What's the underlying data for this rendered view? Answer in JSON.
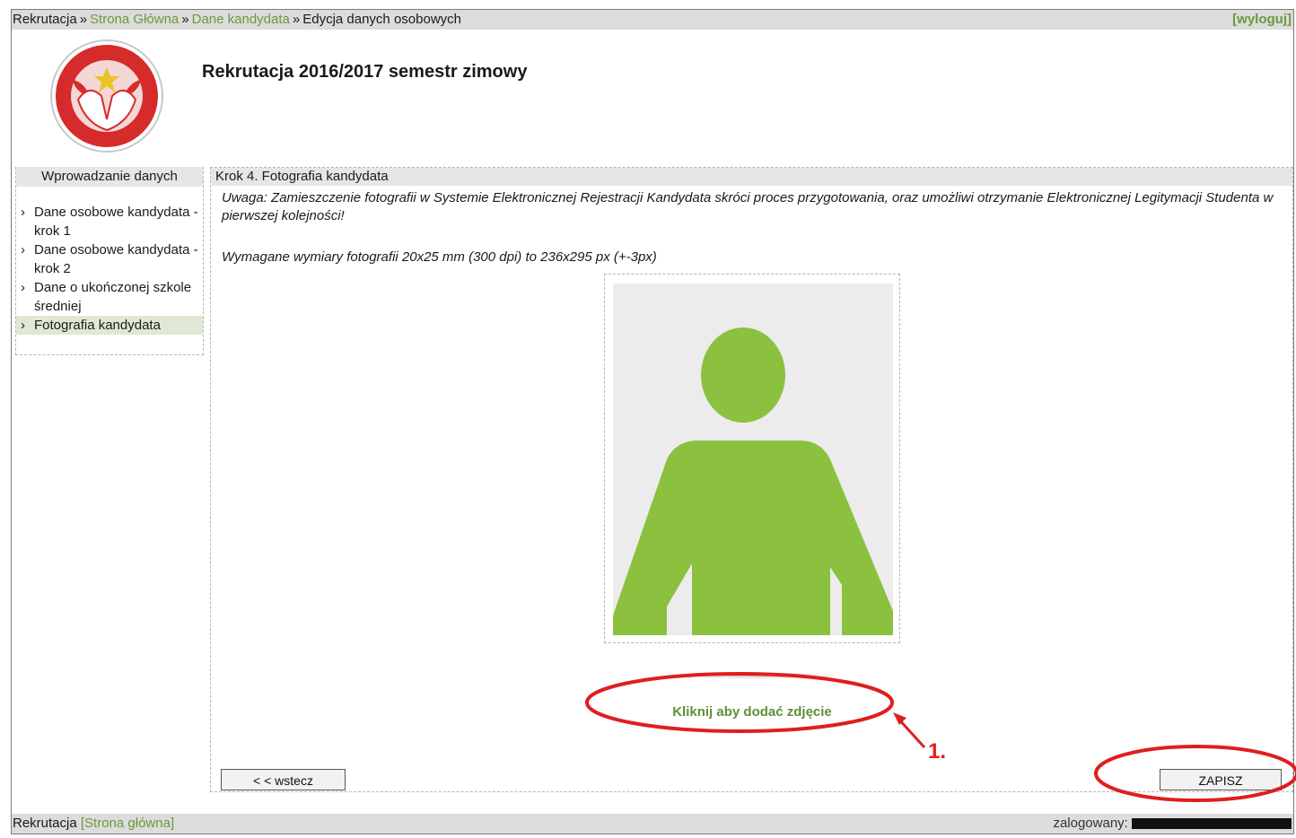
{
  "breadcrumb": {
    "root": "Rekrutacja",
    "separator": "»",
    "items": [
      "Strona Główna",
      "Dane kandydata"
    ],
    "current": "Edycja danych osobowych"
  },
  "logout_label": "[wyloguj]",
  "page_title": "Rekrutacja 2016/2017 semestr zimowy",
  "sidebar": {
    "heading": "Wprowadzanie danych",
    "chevron": "›",
    "items": [
      {
        "label": "Dane osobowe kandydata - krok 1"
      },
      {
        "label": "Dane osobowe kandydata - krok 2"
      },
      {
        "label": "Dane o ukończonej szkole średniej"
      },
      {
        "label": "Fotografia kandydata"
      }
    ]
  },
  "content": {
    "step_title": "Krok 4. Fotografia kandydata",
    "notice": "Uwaga: Zamieszczenie fotografii w Systemie Elektronicznej Rejestracji Kandydata skróci proces przygotowania, oraz umożliwi otrzymanie Elektronicznej Legitymacji Studenta w pierwszej kolejności!",
    "dimensions": "Wymagane wymiary fotografii 20x25 mm (300 dpi) to 236x295 px (+-3px)",
    "add_photo_label": "Kliknij aby dodać zdjęcie",
    "back_label": "< < wstecz",
    "save_label": "ZAPISZ"
  },
  "footer": {
    "root": "Rekrutacja",
    "home_link": "[Strona główna]",
    "logged_in_label": "zalogowany:"
  },
  "annotation": {
    "marker": "1."
  },
  "colors": {
    "link_green": "#6b9a3c",
    "placeholder_green": "#8cc13f",
    "annotation_red": "#e01e1e"
  }
}
